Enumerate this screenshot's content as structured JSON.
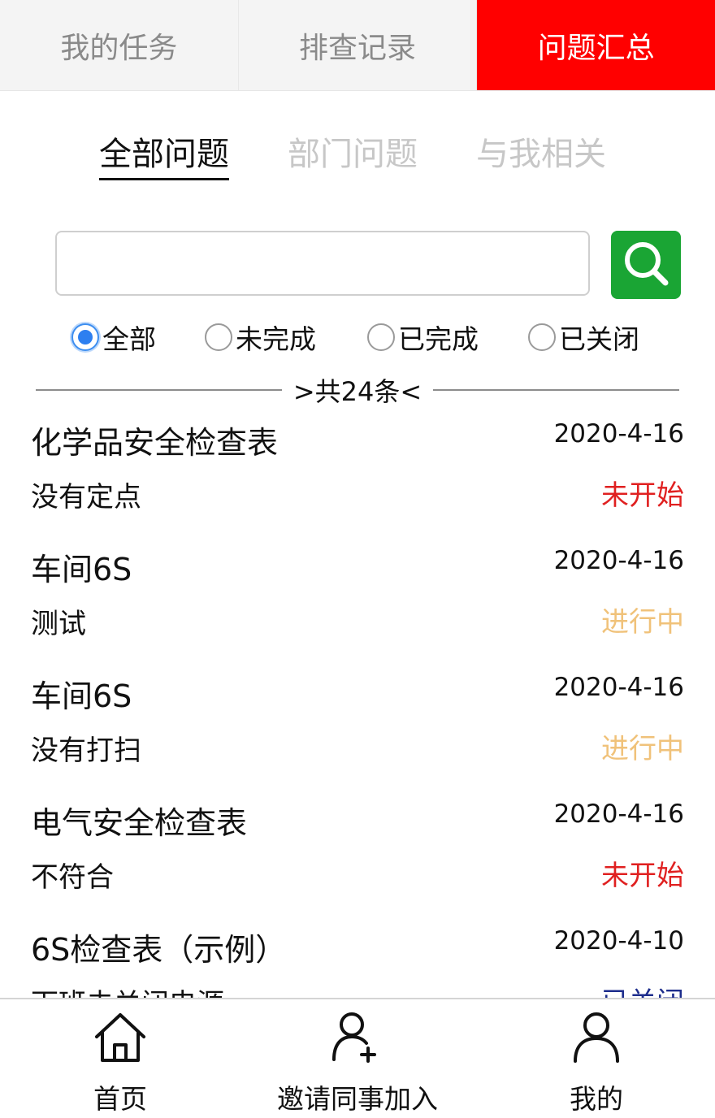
{
  "colors": {
    "accent": "#ff0000",
    "search_button": "#1aa534",
    "radio_selected": "#2d7ff0",
    "status_not_started": "#e02020",
    "status_in_progress": "#f0c27a",
    "status_closed": "#1d2d8c"
  },
  "top_tabs": [
    {
      "label": "我的任务",
      "active": false
    },
    {
      "label": "排查记录",
      "active": false
    },
    {
      "label": "问题汇总",
      "active": true
    }
  ],
  "sub_tabs": [
    {
      "label": "全部问题",
      "active": true
    },
    {
      "label": "部门问题",
      "active": false
    },
    {
      "label": "与我相关",
      "active": false
    }
  ],
  "search": {
    "value": "",
    "placeholder": "",
    "button_icon": "search-icon"
  },
  "filters": [
    {
      "label": "全部",
      "checked": true
    },
    {
      "label": "未完成",
      "checked": false
    },
    {
      "label": "已完成",
      "checked": false
    },
    {
      "label": "已关闭",
      "checked": false
    }
  ],
  "count_text": ">共24条<",
  "items": [
    {
      "title": "化学品安全检查表",
      "date": "2020-4-16",
      "desc": "没有定点",
      "status": "未开始",
      "status_kind": "not_started"
    },
    {
      "title": "车间6S",
      "date": "2020-4-16",
      "desc": "测试",
      "status": "进行中",
      "status_kind": "in_progress"
    },
    {
      "title": "车间6S",
      "date": "2020-4-16",
      "desc": "没有打扫",
      "status": "进行中",
      "status_kind": "in_progress"
    },
    {
      "title": "电气安全检查表",
      "date": "2020-4-16",
      "desc": "不符合",
      "status": "未开始",
      "status_kind": "not_started"
    },
    {
      "title": "6S检查表（示例）",
      "date": "2020-4-10",
      "desc": "下班未关闭电源",
      "status": "已关闭",
      "status_kind": "closed"
    }
  ],
  "bottom_nav": [
    {
      "label": "首页",
      "icon": "home-icon"
    },
    {
      "label": "邀请同事加入",
      "icon": "add-user-icon"
    },
    {
      "label": "我的",
      "icon": "user-icon"
    }
  ]
}
